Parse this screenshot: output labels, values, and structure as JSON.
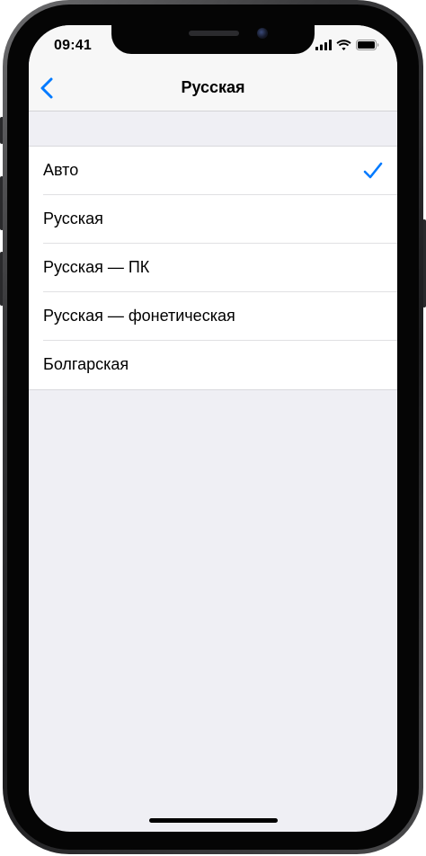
{
  "status_bar": {
    "time": "09:41"
  },
  "nav": {
    "title": "Русская",
    "back_icon": "chevron-left-icon"
  },
  "keyboard_layouts": [
    {
      "label": "Авто",
      "selected": true
    },
    {
      "label": "Русская",
      "selected": false
    },
    {
      "label": "Русская — ПК",
      "selected": false
    },
    {
      "label": "Русская — фонетическая",
      "selected": false
    },
    {
      "label": "Болгарская",
      "selected": false
    }
  ],
  "colors": {
    "accent": "#007aff",
    "grouped_background": "#efeff4",
    "bar_background": "#f7f7f7"
  }
}
